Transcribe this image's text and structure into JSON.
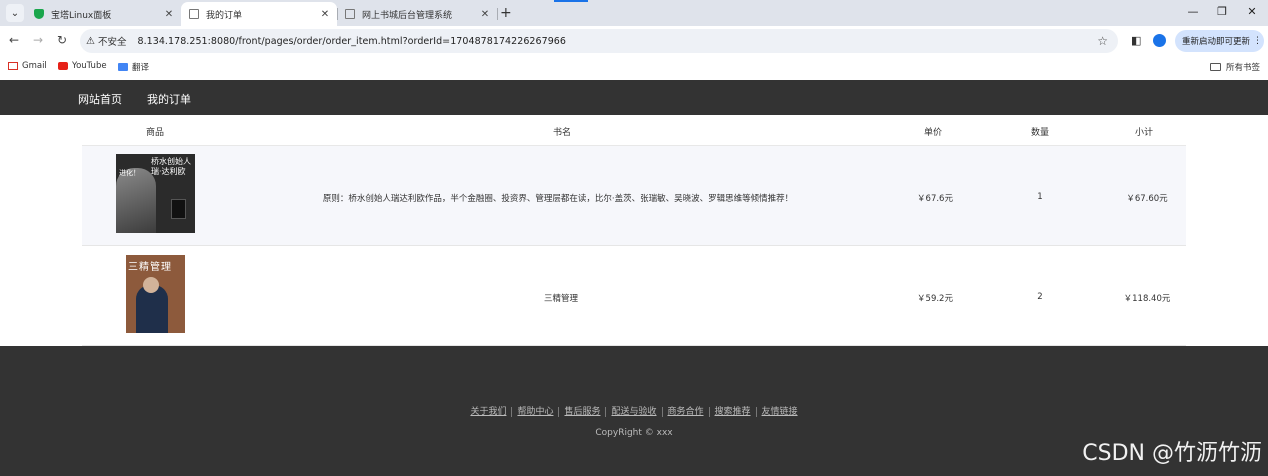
{
  "browser": {
    "tabs": [
      {
        "label": "宝塔Linux面板",
        "active": false
      },
      {
        "label": "我的订单",
        "active": true
      },
      {
        "label": "网上书城后台管理系统",
        "active": false
      }
    ],
    "address": {
      "security": "不安全",
      "url": "8.134.178.251:8080/front/pages/order/order_item.html?orderId=1704878174226267966"
    },
    "restart_label": "重新启动即可更新",
    "bookmarks": [
      {
        "label": "Gmail",
        "icon": "gmail-icon"
      },
      {
        "label": "YouTube",
        "icon": "youtube-icon"
      },
      {
        "label": "翻译",
        "icon": "translate-icon"
      }
    ],
    "all_bookmarks": "所有书签"
  },
  "site": {
    "nav": {
      "home": "网站首页",
      "orders": "我的订单"
    },
    "table": {
      "headers": {
        "product": "商品",
        "name": "书名",
        "price": "单价",
        "qty": "数量",
        "subtotal": "小计"
      },
      "rows": [
        {
          "cover_title": "桥水创始人\n瑞·达利欧",
          "cover_side": "进化！",
          "name": "原则：桥水创始人瑞达利欧作品，半个金融圈、投资界、管理层都在读，比尔·盖茨、张瑞敏、吴晓波、罗辑思维等倾情推荐！",
          "price": "￥67.6元",
          "qty": "1",
          "subtotal": "￥67.60元"
        },
        {
          "cover_title": "三精管理",
          "name": "三精管理",
          "price": "￥59.2元",
          "qty": "2",
          "subtotal": "￥118.40元"
        }
      ]
    },
    "footer": {
      "links": [
        "关于我们",
        "帮助中心",
        "售后服务",
        "配送与验收",
        "商务合作",
        "搜索推荐",
        "友情链接"
      ],
      "copyright": "CopyRight © xxx"
    },
    "watermark": "CSDN @竹沥竹沥"
  }
}
